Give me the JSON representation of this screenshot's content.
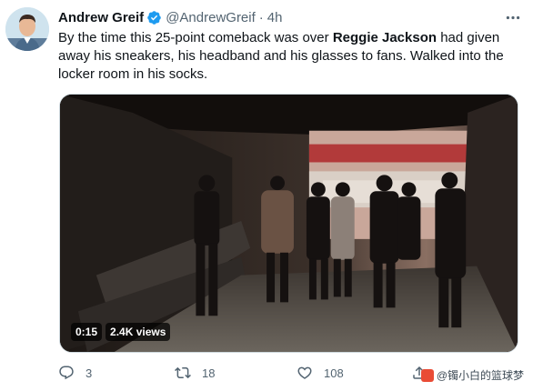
{
  "author": {
    "display_name": "Andrew Greif",
    "handle": "@AndrewGreif",
    "separator": "·",
    "time": "4h"
  },
  "tweet": {
    "text_before": "By the time this 25-point comeback was over ",
    "mention": "Reggie Jackson",
    "text_after": " had given away his sneakers, his headband and his glasses to fans. Walked into the locker room in his socks."
  },
  "media": {
    "duration": "0:15",
    "views": "2.4K views"
  },
  "actions": {
    "reply_count": "3",
    "retweet_count": "18",
    "like_count": "108"
  },
  "watermark": {
    "text": "@镯小白的篮球梦"
  },
  "colors": {
    "text_primary": "#0f1419",
    "text_secondary": "#536471",
    "verified_blue": "#1d9bf0"
  }
}
